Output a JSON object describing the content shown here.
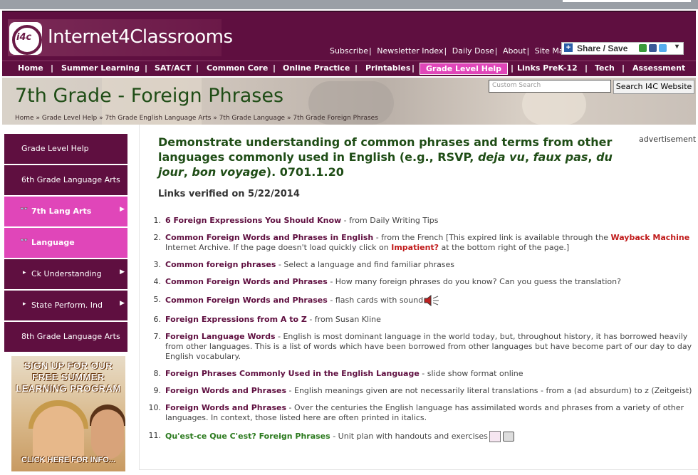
{
  "header": {
    "logo_badge": "i4c",
    "logo_text": "Internet4Classrooms",
    "top_links": [
      "Subscribe",
      "Newsletter Index",
      "Daily Dose",
      "About",
      "Site Map"
    ],
    "share_label": "Share / Save"
  },
  "nav": {
    "items": [
      "Home",
      "Summer Learning",
      "SAT/ACT",
      "Common Core",
      "Online Practice",
      "Printables",
      "Grade Level Help",
      "Links PreK-12",
      "Tech",
      "Assessment"
    ],
    "active": "Grade Level Help"
  },
  "banner": {
    "title_part1": "7th Grade",
    "title_sep": " - ",
    "title_part2": "Foreign Phrases",
    "breadcrumbs": [
      "Home",
      "Grade Level Help",
      "7th Grade English Language Arts",
      "7th Grade Language",
      "7th Grade Foreign Phrases"
    ],
    "search_placeholder": "Custom Search",
    "search_button": "Search I4C Website"
  },
  "sidebar": {
    "items": [
      {
        "label": "Grade Level Help"
      },
      {
        "label": "6th Grade Language Arts"
      },
      {
        "label": "7th Lang Arts"
      },
      {
        "label": "Language"
      },
      {
        "label": "Ck Understanding"
      },
      {
        "label": "State Perform. Ind"
      },
      {
        "label": "8th Grade Language Arts"
      }
    ],
    "promo_top": "SIGN UP FOR OUR FREE SUMMER LEARNING PROGRAM",
    "promo_bottom": "CLICK HERE FOR INFO..."
  },
  "main": {
    "heading_a": "Demonstrate understanding of common phrases and terms from other languages commonly used in English (e.g., RSVP,  ",
    "heading_i1": "deja vu",
    "heading_c1": ", ",
    "heading_i2": "faux pas",
    "heading_c2": ", ",
    "heading_i3": "du jour",
    "heading_c3": ", ",
    "heading_i4": "bon voyage",
    "heading_end": "). 0701.1.20",
    "verified": "Links verified on 5/22/2014",
    "advertisement": "advertisement",
    "links": [
      {
        "num": "1.",
        "title": "6 Foreign Expressions You Should Know",
        "desc": " - from Daily Writing Tips"
      },
      {
        "num": "2.",
        "title": "Common Foreign Words and Phrases in English",
        "desc1": "  - from the French [This expired link is available through the ",
        "red1": "Wayback Machine",
        "desc2": " Internet Archive. If the page doesn't load quickly click on ",
        "red2": "Impatient?",
        "desc3": " at the bottom right of the page.]"
      },
      {
        "num": "3.",
        "title": "Common foreign phrases",
        "desc": " - Select a language and find familiar phrases"
      },
      {
        "num": "4.",
        "title": "Common Foreign Words and Phrases",
        "desc": " - How many foreign phrases do you know? Can you guess the translation?"
      },
      {
        "num": "5.",
        "title": "Common Foreign Words and Phrases",
        "desc": " - flash cards with sound"
      },
      {
        "num": "6.",
        "title": "Foreign Expressions from A to Z",
        "desc": " - from Susan Kline"
      },
      {
        "num": "7.",
        "title": "Foreign Language Words",
        "desc": "  - English is most dominant language in the world today, but, throughout history, it has borrowed heavily from other languages. This is a list of words which have been borrowed from other languages but have become part of our day to day English vocabulary."
      },
      {
        "num": "8.",
        "title": "Foreign Phrases Commonly Used in the English Language",
        "desc": "    - slide show format online"
      },
      {
        "num": "9.",
        "title": "Foreign Words and Phrases",
        "desc": " - English meanings given are not necessarily literal translations - from a (ad absurdum) to z (Zeitgeist)"
      },
      {
        "num": "10.",
        "title": "Foreign Words and Phrases",
        "desc": " - Over the centuries the English language has assimilated words and phrases from a variety of other languages. In context, those listed here are often printed in italics."
      },
      {
        "num": "11.",
        "title": "Qu'est-ce Que C'est? Foreign Phrases",
        "desc": " - Unit plan with handouts and exercises"
      }
    ]
  }
}
